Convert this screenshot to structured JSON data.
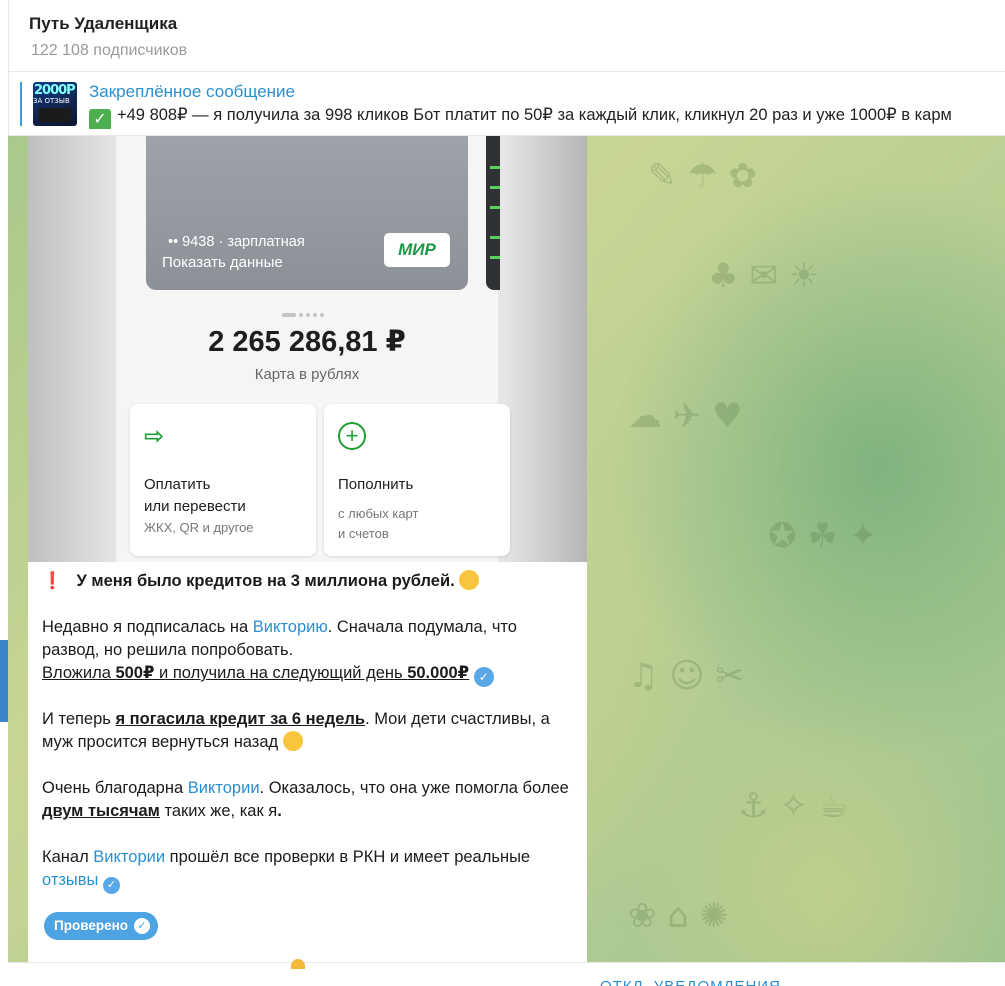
{
  "header": {
    "title": "Путь Удаленщика",
    "subscribers": "122 108 подписчиков"
  },
  "pinned": {
    "label": "Закреплённое сообщение",
    "thumb_text": "2000Р",
    "thumb_sub": "ЗА ОТЗЫВ",
    "text": "+49 808₽ — я получила за 998 кликов  Бот платит по 50₽ за каждый клик, кликнул 20 раз и уже 1000₽ в карм"
  },
  "photo": {
    "card_number": "•• 9438 · зарплатная",
    "card_show": "Показать данные",
    "card_brand": "МИР",
    "balance": "2 265 286,81 ₽",
    "balance_sub": "Карта в рублях",
    "tile_pay_line1": "Оплатить",
    "tile_pay_line2": "или перевести",
    "tile_pay_sub": "ЖКХ, QR и другое",
    "tile_topup_title": "Пополнить",
    "tile_topup_sub1": "с любых карт",
    "tile_topup_sub2": "и счетов"
  },
  "message": {
    "headline": "У меня было кредитов на 3 миллиона рублей.",
    "p1_a": "Недавно я подписалась на ",
    "p1_link": "Викторию",
    "p1_b": ". Сначала подумала, что развод, но решила попробовать.",
    "p1_line2_a": "Вложила ",
    "p1_line2_b": "500₽",
    "p1_line2_c": " и получила на следующий день ",
    "p1_line2_d": "50.000₽",
    "p2_a": "И теперь ",
    "p2_b": "я погасила кредит за 6 недель",
    "p2_c": ". Мои дети счастливы, а муж просится вернуться назад",
    "p3_a": "Очень благодарна ",
    "p3_link": "Виктории",
    "p3_b": ". Оказалось, что она уже помогла более ",
    "p3_c": "двум тысячам",
    "p3_d": " таких же, как я",
    "p3_e": ".",
    "p4_a": "Канал ",
    "p4_link": "Виктории",
    "p4_b": " прошёл все проверки в РКН и имеет реальные ",
    "p4_link2": "отзывы",
    "button": "Проверено"
  },
  "bottom": {
    "link": "ОТКЛ. УВЕДОМЛЕНИЯ"
  },
  "colors": {
    "accent": "#2a8fd0",
    "button": "#4ea3e3",
    "green": "#21a038",
    "alert": "#e0262b"
  }
}
